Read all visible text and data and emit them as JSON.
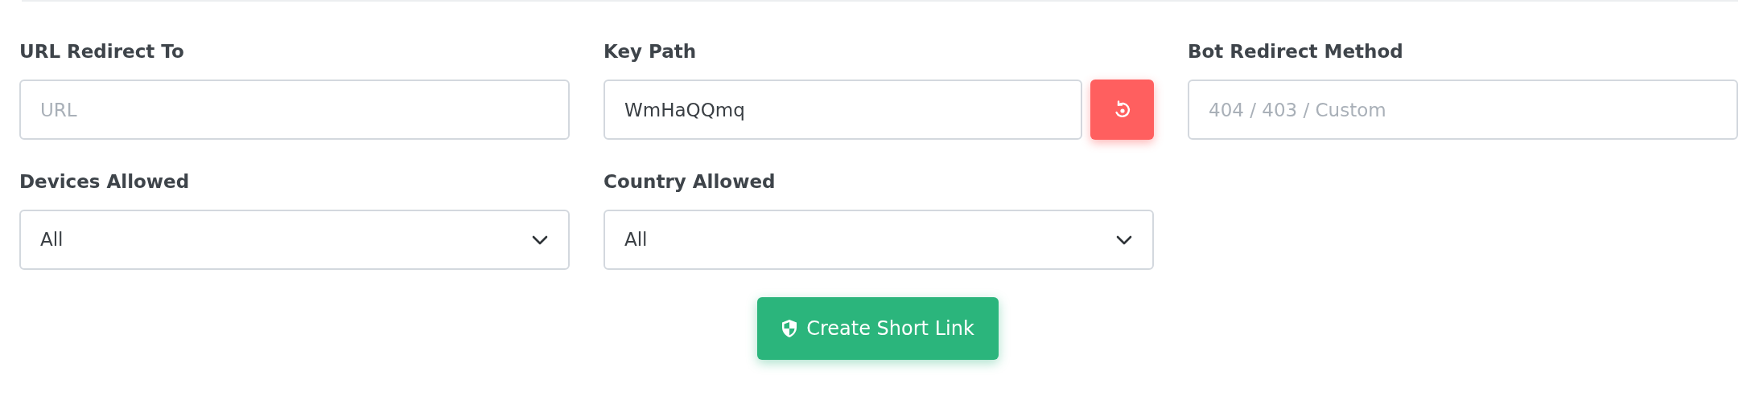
{
  "fields": [
    {
      "kind": "text",
      "label": "URL Redirect To",
      "placeholder": "URL"
    },
    {
      "kind": "text_regenerate",
      "label": "Key Path",
      "value": "WmHaQQmq"
    },
    {
      "kind": "text",
      "label": "Bot Redirect Method",
      "placeholder": "404 / 403 / Custom"
    },
    {
      "kind": "select",
      "label": "Devices Allowed",
      "value": "All"
    },
    {
      "kind": "select",
      "label": "Country Allowed",
      "value": "All"
    }
  ],
  "submit": {
    "label": "Create Short Link"
  }
}
